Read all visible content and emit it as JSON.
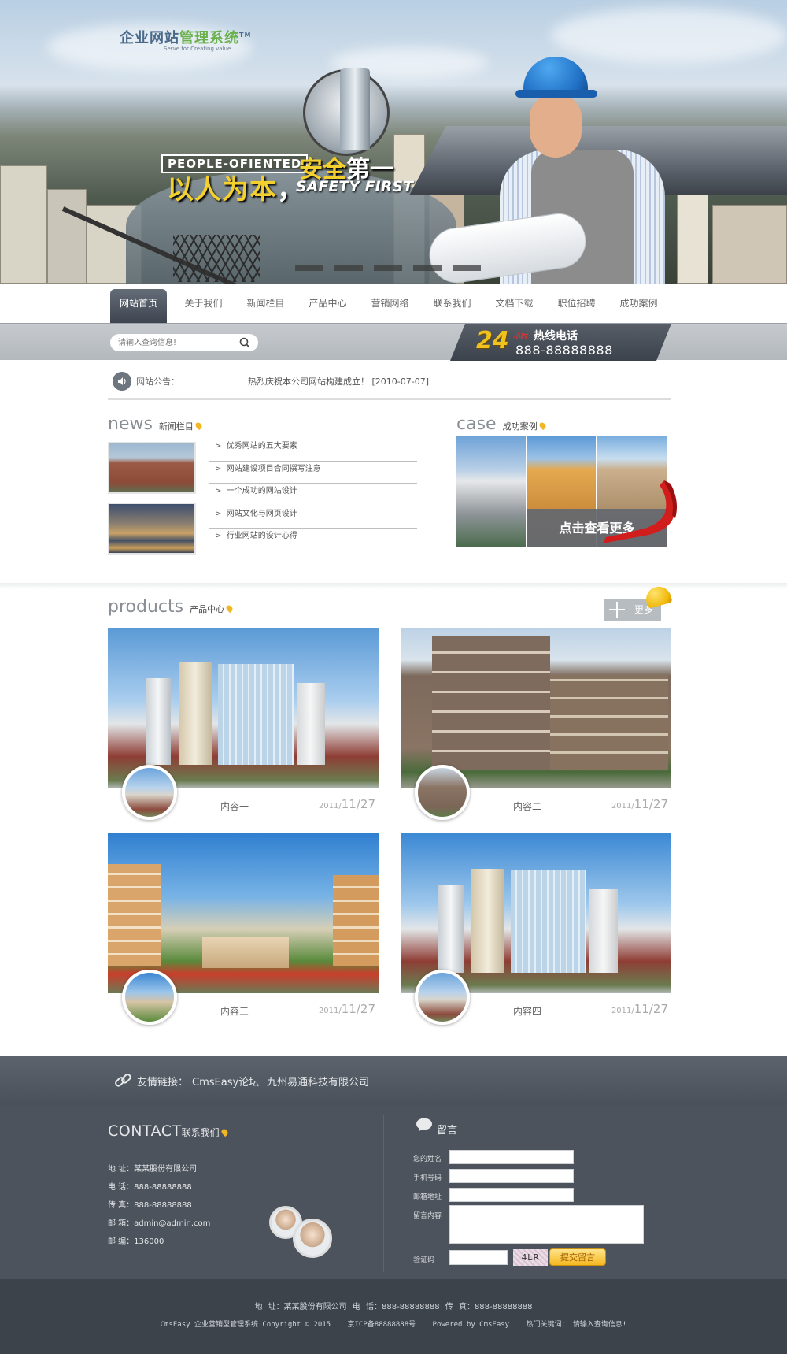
{
  "banner": {
    "logo_main": "企业网站",
    "logo_accent": "管理系统",
    "logo_tm": "TM",
    "logo_sub": "Serve for Creating value",
    "slogan_en": "PEOPLE-OFIENTED",
    "slogan_cn1a": "以人为本",
    "slogan_cn1b": "，",
    "slogan_cn2a": "安全",
    "slogan_cn2b": "第一",
    "slogan_en2": "SAFETY FIRST"
  },
  "nav": {
    "items": [
      "网站首页",
      "关于我们",
      "新闻栏目",
      "产品中心",
      "营销网络",
      "联系我们",
      "文档下载",
      "职位招聘",
      "成功案例"
    ]
  },
  "search": {
    "placeholder": "请输入查询信息!"
  },
  "hotline": {
    "number_24": "24",
    "hours": "小时",
    "label": "热线电话",
    "phone": "888-88888888"
  },
  "notice": {
    "label": "网站公告：",
    "text": "热烈庆祝本公司网站构建成立！ [2010-07-07]"
  },
  "news": {
    "title_en": "news",
    "title_cn": "新闻栏目",
    "items": [
      "优秀网站的五大要素",
      "网站建设项目合同撰写注意",
      "一个成功的网站设计",
      "网站文化与网页设计",
      "行业网站的设计心得"
    ]
  },
  "case": {
    "title_en": "case",
    "title_cn": "成功案例",
    "more": "点击查看更多"
  },
  "products": {
    "title_en": "products",
    "title_cn": "产品中心",
    "more": "更多",
    "items": [
      {
        "name": "内容一",
        "year": "2011/",
        "date": "11/27"
      },
      {
        "name": "内容二",
        "year": "2011/",
        "date": "11/27"
      },
      {
        "name": "内容三",
        "year": "2011/",
        "date": "11/27"
      },
      {
        "name": "内容四",
        "year": "2011/",
        "date": "11/27"
      }
    ]
  },
  "friend_links": {
    "label": "友情链接：",
    "links": [
      "CmsEasy论坛",
      "九州易通科技有限公司"
    ]
  },
  "contact": {
    "title_en": "CONTACT",
    "title_cn": "联系我们",
    "lines": [
      "地 址：某某股份有限公司",
      "电 话：888-88888888",
      "传 真：888-88888888",
      "邮 箱：admin@admin.com",
      "邮 编：136000"
    ]
  },
  "message": {
    "title": "留言",
    "name_label": "您的姓名",
    "phone_label": "手机号码",
    "email_label": "邮箱地址",
    "content_label": "留言内容",
    "captcha_label": "验证码",
    "captcha_text": "4LR",
    "submit": "提交留言"
  },
  "footer": {
    "line1": "地 址：某某股份有限公司    电 话：888-88888888    传 真：888-88888888",
    "copyright": "CmsEasy 企业营销型管理系统 Copyright © 2015",
    "icp": "京ICP备88888888号",
    "powered": "Powered by CmsEasy",
    "keywords": "热门关键词：  请输入查询信息!"
  },
  "colors": {
    "nav_active": "#4a515b",
    "footer": "#4c535c",
    "accent_yellow": "#f3d02d"
  }
}
